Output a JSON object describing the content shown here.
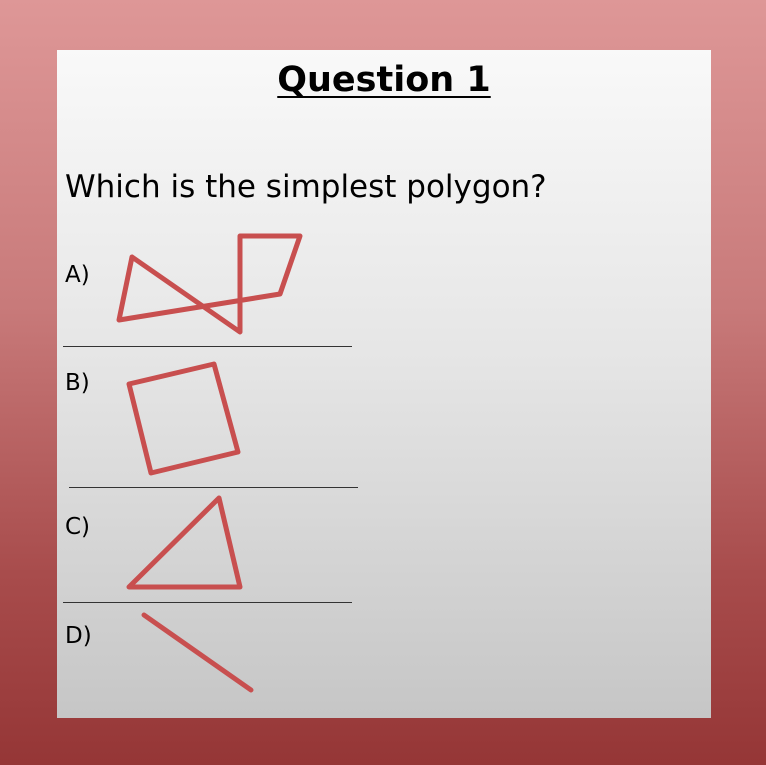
{
  "slide": {
    "title": "Question 1",
    "question": "Which is the simplest polygon?",
    "shape_color": "#c84f4f",
    "options": [
      {
        "label": "A)",
        "shape": "self-intersecting-polygon"
      },
      {
        "label": "B)",
        "shape": "quadrilateral"
      },
      {
        "label": "C)",
        "shape": "triangle"
      },
      {
        "label": "D)",
        "shape": "line-segment"
      }
    ]
  }
}
